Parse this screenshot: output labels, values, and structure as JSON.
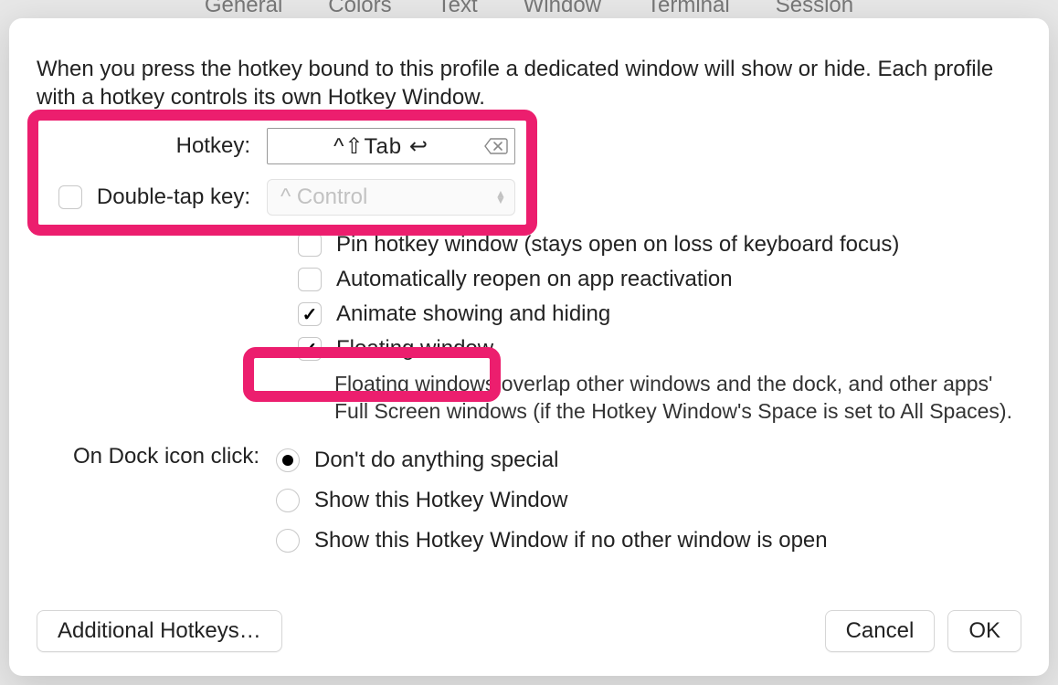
{
  "bg_tabs": [
    "General",
    "Colors",
    "Text",
    "Window",
    "Terminal",
    "Session"
  ],
  "intro": "When you press the hotkey bound to this profile a dedicated window will show or hide. Each profile with a hotkey controls its own Hotkey Window.",
  "hotkey": {
    "label": "Hotkey:",
    "value": "^⇧Tab ↩"
  },
  "doubletap": {
    "label": "Double-tap key:",
    "checked": false,
    "popup_value": "^ Control"
  },
  "checkboxes": {
    "pin": {
      "label": "Pin hotkey window (stays open on loss of keyboard focus)",
      "checked": false
    },
    "reopen": {
      "label": "Automatically reopen on app reactivation",
      "checked": false
    },
    "animate": {
      "label": "Animate showing and hiding",
      "checked": true
    },
    "floating": {
      "label": "Floating window",
      "checked": true
    }
  },
  "floating_help": "Floating windows overlap other windows and the dock, and other apps' Full Screen windows (if the Hotkey Window's Space is set to All Spaces).",
  "dock": {
    "label": "On Dock icon click:",
    "options": [
      {
        "label": "Don't do anything special",
        "selected": true
      },
      {
        "label": "Show this Hotkey Window",
        "selected": false
      },
      {
        "label": "Show this Hotkey Window if no other window is open",
        "selected": false
      }
    ]
  },
  "buttons": {
    "additional": "Additional Hotkeys…",
    "cancel": "Cancel",
    "ok": "OK"
  }
}
